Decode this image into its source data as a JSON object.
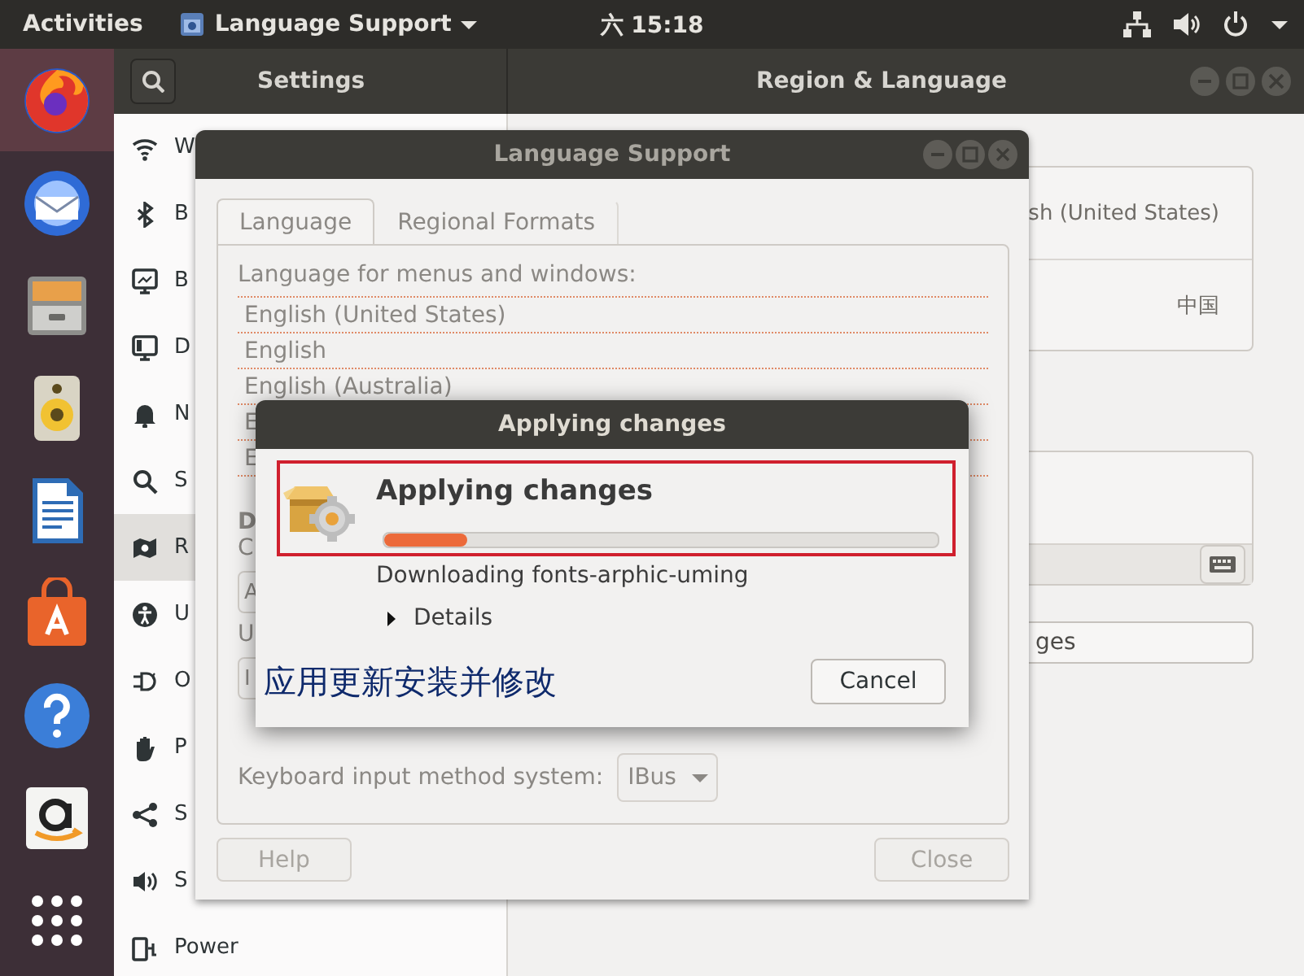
{
  "top_bar": {
    "activities": "Activities",
    "app_menu": "Language Support",
    "clock": "六 15:18"
  },
  "settings": {
    "title": "Settings",
    "panel_title": "Region & Language",
    "sidebar": [
      {
        "label": "W",
        "selected": false
      },
      {
        "label": "B",
        "selected": false
      },
      {
        "label": "B",
        "selected": false
      },
      {
        "label": "D",
        "selected": false
      },
      {
        "label": "N",
        "selected": false
      },
      {
        "label": "S",
        "selected": false
      },
      {
        "label": "R",
        "selected": true
      },
      {
        "label": "U",
        "selected": false
      },
      {
        "label": "O",
        "selected": false
      },
      {
        "label": "P",
        "selected": false
      },
      {
        "label": "S",
        "selected": false
      },
      {
        "label": "S",
        "selected": false
      },
      {
        "label": "Power",
        "selected": false
      }
    ],
    "language_value": "sh (United States)",
    "formats_value": "中国",
    "manage_button": "ges"
  },
  "language_support": {
    "title": "Language Support",
    "tabs": [
      {
        "label": "Language",
        "selected": true
      },
      {
        "label": "Regional Formats",
        "selected": false
      }
    ],
    "list_heading": "Language for menus and windows:",
    "languages": [
      "English (United States)",
      "English",
      "English (Australia)",
      "E",
      "E"
    ],
    "section_heading": "D",
    "section_hint": "C",
    "field_1": "A",
    "hint_2": "U",
    "field_2": "I",
    "input_method_label": "Keyboard input method system:",
    "input_method_value": "IBus",
    "buttons": [
      {
        "label": "Help",
        "disabled": true
      },
      {
        "label": "Close",
        "disabled": true
      }
    ]
  },
  "applying_dialog": {
    "title": "Applying changes",
    "heading": "Applying changes",
    "level": 0.15,
    "status": "Downloading fonts-arphic-uming",
    "details": {
      "label": "Details",
      "expanded": false
    },
    "annotation": "应用更新安装并修改",
    "cancel": "Cancel"
  }
}
